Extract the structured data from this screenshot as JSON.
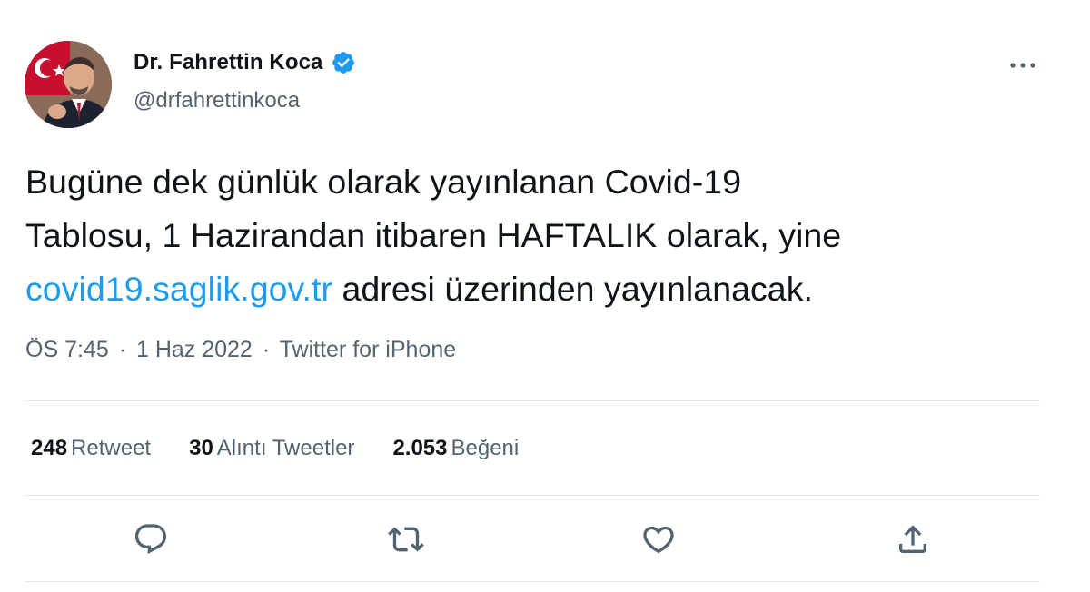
{
  "user": {
    "display_name": "Dr. Fahrettin Koca",
    "handle": "@drfahrettinkoca",
    "verified": true,
    "avatar_icon": "profile-photo"
  },
  "tweet": {
    "lines": [
      {
        "text": "Bugüne dek günlük olarak yayınlanan Covid-19"
      },
      {
        "text": "Tablosu, 1 Hazirandan itibaren HAFTALIK olarak, yine"
      }
    ],
    "link_text": "covid19.saglik.gov.tr",
    "after_link_text": " adresi üzerinden yayınlanacak."
  },
  "meta": {
    "time": "ÖS 7:45",
    "separator": "·",
    "date": "1 Haz 2022",
    "source": "Twitter for iPhone"
  },
  "stats": [
    {
      "count": "248",
      "label": "Retweet"
    },
    {
      "count": "30",
      "label": "Alıntı Tweetler"
    },
    {
      "count": "2.053",
      "label": "Beğeni"
    }
  ],
  "icons": {
    "more": "more-icon",
    "reply": "reply-icon",
    "retweet": "retweet-icon",
    "like": "heart-icon",
    "share": "share-icon",
    "verified": "verified-badge-icon"
  },
  "colors": {
    "text": "#0f1419",
    "secondary": "#536471",
    "link": "#1d9bf0",
    "divider": "#e4e9ec"
  }
}
